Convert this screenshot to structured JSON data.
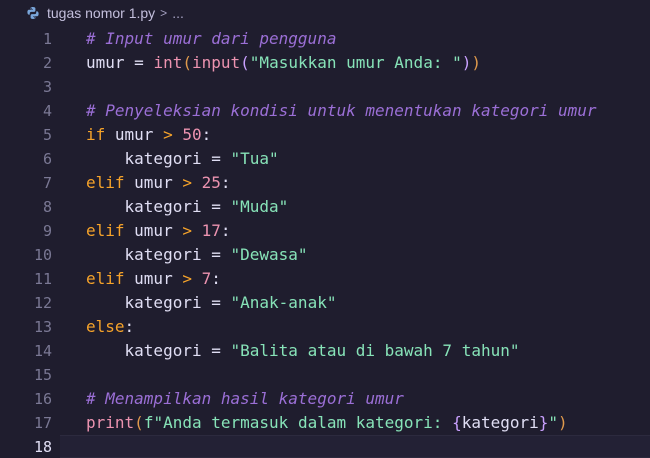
{
  "breadcrumb": {
    "file_icon": "python-file-icon",
    "file": "tugas nomor 1.py",
    "separator": ">",
    "more": "..."
  },
  "colors": {
    "background": "#1f1d2e",
    "comment": "#9b6fd6",
    "keyword": "#f6a32a",
    "string": "#87e3b8",
    "number": "#ec93b0"
  },
  "active_line": 18,
  "line_numbers": [
    "1",
    "2",
    "3",
    "4",
    "5",
    "6",
    "7",
    "8",
    "9",
    "10",
    "11",
    "12",
    "13",
    "14",
    "15",
    "16",
    "17",
    "18"
  ],
  "code": {
    "l1": {
      "comment": "# Input umur dari pengguna"
    },
    "l2": {
      "var": "umur",
      "eq": " = ",
      "int": "int",
      "p1": "(",
      "input": "input",
      "p2": "(",
      "str": "\"Masukkan umur Anda: \"",
      "p3": ")",
      "p4": ")"
    },
    "l4": {
      "comment": "# Penyeleksian kondisi untuk menentukan kategori umur"
    },
    "l5": {
      "kw": "if",
      "var": " umur ",
      "op": ">",
      "num": " 50",
      "colon": ":"
    },
    "l6": {
      "indent": "    ",
      "var": "kategori",
      "eq": " = ",
      "str": "\"Tua\""
    },
    "l7": {
      "kw": "elif",
      "var": " umur ",
      "op": ">",
      "num": " 25",
      "colon": ":"
    },
    "l8": {
      "indent": "    ",
      "var": "kategori",
      "eq": " = ",
      "str": "\"Muda\""
    },
    "l9": {
      "kw": "elif",
      "var": " umur ",
      "op": ">",
      "num": " 17",
      "colon": ":"
    },
    "l10": {
      "indent": "    ",
      "var": "kategori",
      "eq": " = ",
      "str": "\"Dewasa\""
    },
    "l11": {
      "kw": "elif",
      "var": " umur ",
      "op": ">",
      "num": " 7",
      "colon": ":"
    },
    "l12": {
      "indent": "    ",
      "var": "kategori",
      "eq": " = ",
      "str": "\"Anak-anak\""
    },
    "l13": {
      "kw": "else",
      "colon": ":"
    },
    "l14": {
      "indent": "    ",
      "var": "kategori",
      "eq": " = ",
      "str": "\"Balita atau di bawah 7 tahun\""
    },
    "l16": {
      "comment": "# Menampilkan hasil kategori umur"
    },
    "l17": {
      "print": "print",
      "p1": "(",
      "fstr_a": "f\"Anda termasuk dalam kategori: ",
      "lb": "{",
      "var": "kategori",
      "rb": "}",
      "fstr_b": "\"",
      "p2": ")"
    }
  }
}
